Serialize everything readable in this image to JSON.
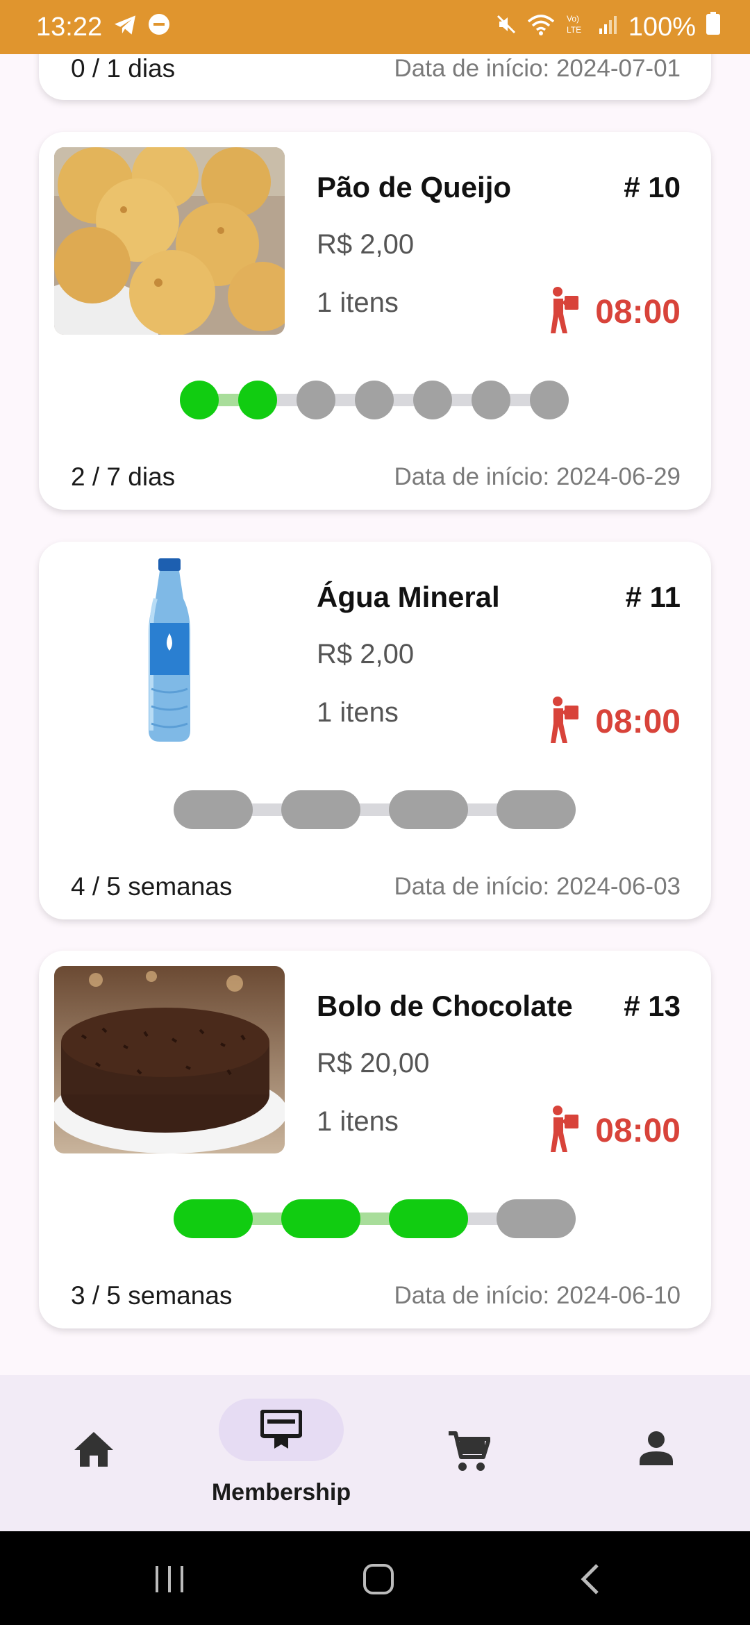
{
  "status_bar": {
    "time": "13:22",
    "battery": "100%",
    "icons": [
      "telegram-icon",
      "do-not-disturb-icon",
      "mute-icon",
      "wifi-icon",
      "volte-icon",
      "signal-icon",
      "battery-icon"
    ]
  },
  "partial_card": {
    "progress_text": "0 / 1 dias",
    "start_date": "Data de início: 2024-07-01"
  },
  "cards": [
    {
      "title": "Pão de Queijo",
      "number": "# 10",
      "price": "R$ 2,00",
      "items": "1 itens",
      "time": "08:00",
      "progress_text": "2 / 7 dias",
      "start_date": "Data de início: 2024-06-29",
      "completed": 2,
      "total": 7
    },
    {
      "title": "Água Mineral",
      "number": "# 11",
      "price": "R$ 2,00",
      "items": "1 itens",
      "time": "08:00",
      "progress_text": "4 / 5 semanas",
      "start_date": "Data de início: 2024-06-03",
      "completed": 0,
      "total": 4
    },
    {
      "title": "Bolo de Chocolate",
      "number": "# 13",
      "price": "R$ 20,00",
      "items": "1 itens",
      "time": "08:00",
      "progress_text": "3 / 5 semanas",
      "start_date": "Data de início: 2024-06-10",
      "completed": 3,
      "total": 4
    }
  ],
  "bottom_nav": {
    "items": [
      "home-icon",
      "membership-icon",
      "cart-icon",
      "profile-icon"
    ],
    "active_label": "Membership"
  },
  "colors": {
    "status_bar": "#e0952e",
    "accent_red": "#d8433a",
    "progress_done": "#11cc11",
    "progress_pending": "#a2a2a2"
  }
}
